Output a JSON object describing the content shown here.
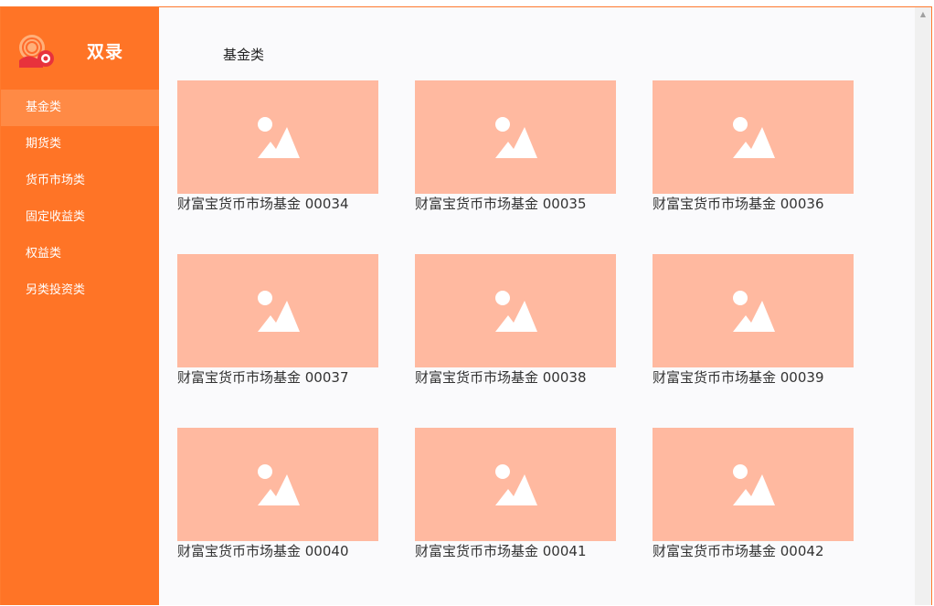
{
  "app": {
    "title": "双录"
  },
  "sidebar": {
    "items": [
      {
        "label": "基金类",
        "active": true
      },
      {
        "label": "期货类",
        "active": false
      },
      {
        "label": "货币市场类",
        "active": false
      },
      {
        "label": "固定收益类",
        "active": false
      },
      {
        "label": "权益类",
        "active": false
      },
      {
        "label": "另类投资类",
        "active": false
      }
    ]
  },
  "main": {
    "section_title": "基金类",
    "cards": [
      {
        "label": "财富宝货币市场基金 00034",
        "icon": "image-placeholder-icon"
      },
      {
        "label": "财富宝货币市场基金 00035",
        "icon": "image-placeholder-icon"
      },
      {
        "label": "财富宝货币市场基金 00036",
        "icon": "image-placeholder-icon"
      },
      {
        "label": "财富宝货币市场基金 00037",
        "icon": "image-placeholder-icon"
      },
      {
        "label": "财富宝货币市场基金 00038",
        "icon": "image-placeholder-icon"
      },
      {
        "label": "财富宝货币市场基金 00039",
        "icon": "image-placeholder-icon"
      },
      {
        "label": "财富宝货币市场基金 00040",
        "icon": "image-placeholder-icon"
      },
      {
        "label": "财富宝货币市场基金 00041",
        "icon": "image-placeholder-icon"
      },
      {
        "label": "财富宝货币市场基金 00042",
        "icon": "image-placeholder-icon"
      }
    ]
  },
  "colors": {
    "sidebar": "#ff7426",
    "sidebar_active": "#ff8a45",
    "thumbnail": "#ffb9a0",
    "border": "#ff7a2e"
  }
}
